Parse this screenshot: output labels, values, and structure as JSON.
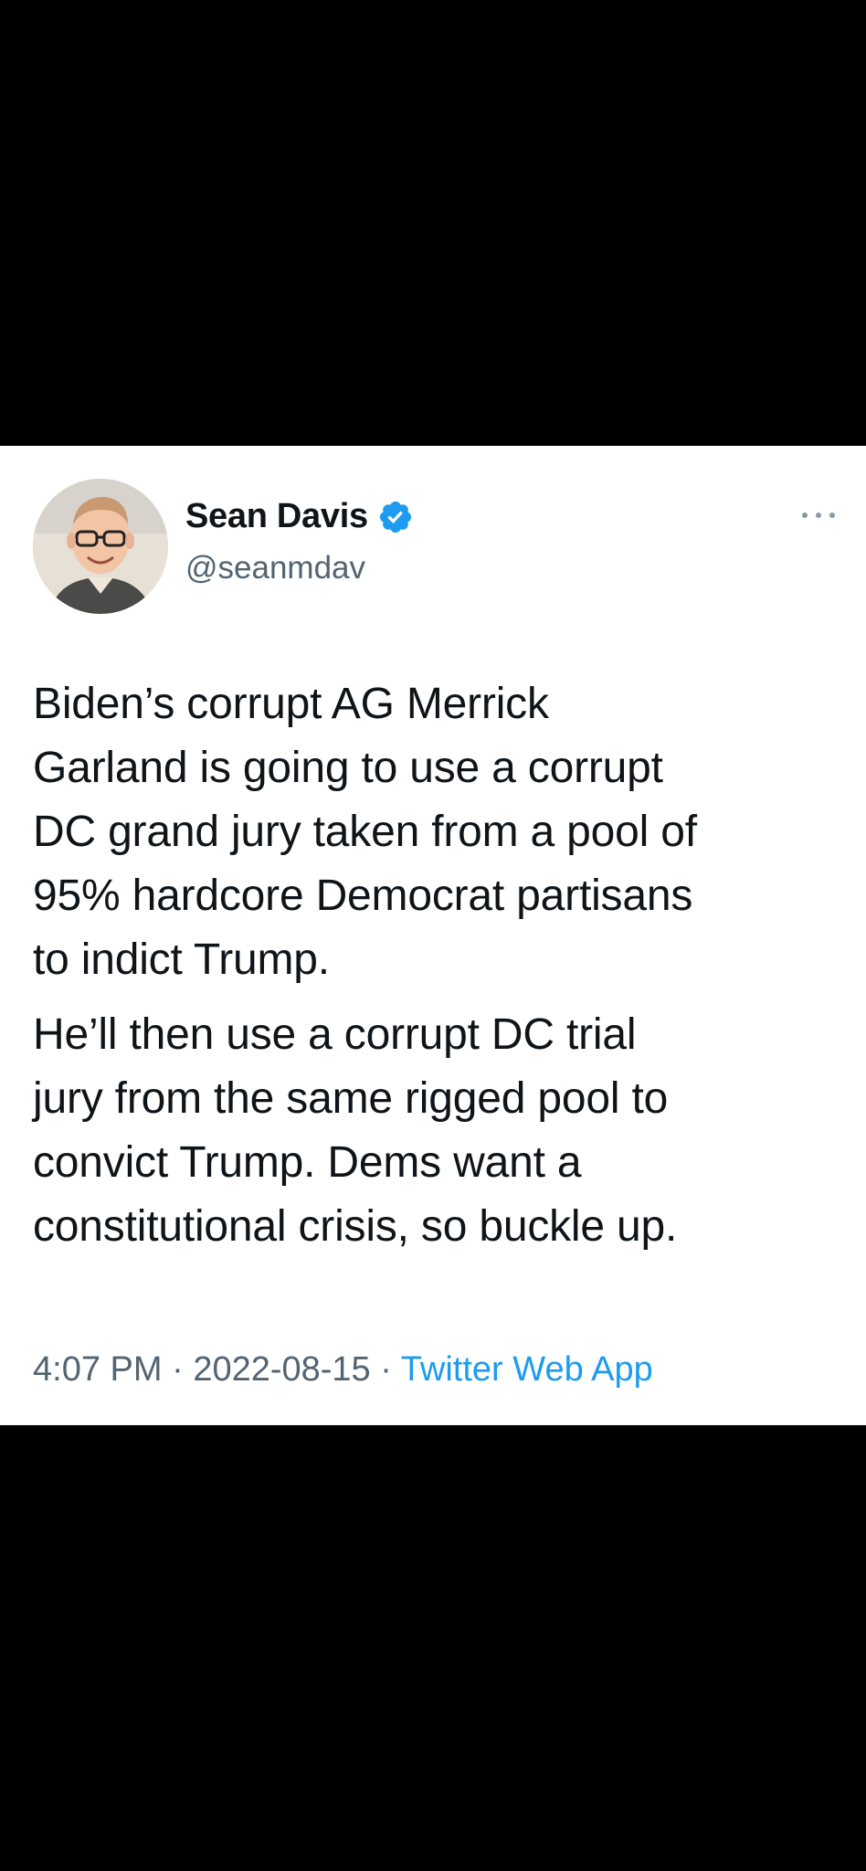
{
  "tweet": {
    "author": {
      "display_name": "Sean Davis",
      "handle": "@seanmdav",
      "verified_icon": "verified-badge-icon",
      "avatar_icon": "avatar"
    },
    "paragraphs": [
      "Biden’s corrupt AG Merrick\nGarland is going to use a corrupt\nDC grand jury taken from a pool of\n95% hardcore Democrat partisans\nto indict Trump.",
      "He’ll then use a corrupt DC trial\njury from the same rigged pool to\nconvict Trump. Dems want a\nconstitutional crisis, so buckle up."
    ],
    "time": "4:07 PM",
    "separator": " · ",
    "date": "2022-08-15",
    "source": "Twitter Web App"
  },
  "colors": {
    "accent": "#1d9bf0",
    "text_primary": "#0f1419",
    "text_secondary": "#536471",
    "background": "#000000",
    "card": "#ffffff"
  }
}
